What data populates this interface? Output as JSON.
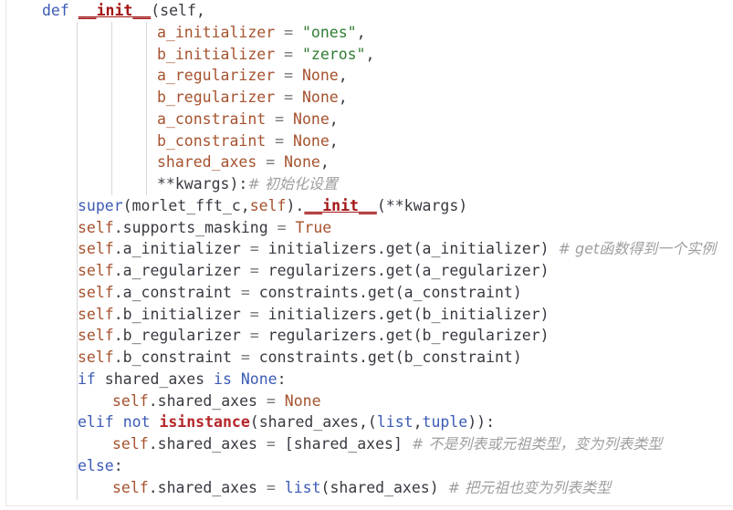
{
  "code": {
    "lines": [
      {
        "indent": 0,
        "tokens": [
          {
            "t": "def",
            "c": "kw"
          },
          {
            "t": " ",
            "c": ""
          },
          {
            "t": "__init__",
            "c": "dunder"
          },
          {
            "t": "(self,",
            "c": "call"
          }
        ]
      },
      {
        "indent": 1,
        "tokens": [
          {
            "t": "a_initializer",
            "c": "param"
          },
          {
            "t": " = ",
            "c": "op"
          },
          {
            "t": "\"ones\"",
            "c": "str"
          },
          {
            "t": ",",
            "c": "call"
          }
        ]
      },
      {
        "indent": 1,
        "tokens": [
          {
            "t": "b_initializer",
            "c": "param"
          },
          {
            "t": " = ",
            "c": "op"
          },
          {
            "t": "\"zeros\"",
            "c": "str"
          },
          {
            "t": ",",
            "c": "call"
          }
        ]
      },
      {
        "indent": 1,
        "tokens": [
          {
            "t": "a_regularizer",
            "c": "param"
          },
          {
            "t": " = ",
            "c": "op"
          },
          {
            "t": "None",
            "c": "const"
          },
          {
            "t": ",",
            "c": "call"
          }
        ]
      },
      {
        "indent": 1,
        "tokens": [
          {
            "t": "b_regularizer",
            "c": "param"
          },
          {
            "t": " = ",
            "c": "op"
          },
          {
            "t": "None",
            "c": "const"
          },
          {
            "t": ",",
            "c": "call"
          }
        ]
      },
      {
        "indent": 1,
        "tokens": [
          {
            "t": "a_constraint",
            "c": "param"
          },
          {
            "t": " = ",
            "c": "op"
          },
          {
            "t": "None",
            "c": "const"
          },
          {
            "t": ",",
            "c": "call"
          }
        ]
      },
      {
        "indent": 1,
        "tokens": [
          {
            "t": "b_constraint",
            "c": "param"
          },
          {
            "t": " = ",
            "c": "op"
          },
          {
            "t": "None",
            "c": "const"
          },
          {
            "t": ",",
            "c": "call"
          }
        ]
      },
      {
        "indent": 1,
        "tokens": [
          {
            "t": "shared_axes",
            "c": "param"
          },
          {
            "t": " = ",
            "c": "op"
          },
          {
            "t": "None",
            "c": "const"
          },
          {
            "t": ",",
            "c": "call"
          }
        ]
      },
      {
        "indent": 1,
        "tokens": [
          {
            "t": "**kwargs",
            "c": "call"
          },
          {
            "t": "):",
            "c": "call"
          },
          {
            "t": "# 初始化设置",
            "c": "cmt"
          }
        ]
      },
      {
        "indent": 2,
        "tokens": [
          {
            "t": "super",
            "c": "kw"
          },
          {
            "t": "(morlet_fft_c,",
            "c": "call"
          },
          {
            "t": "self",
            "c": "self"
          },
          {
            "t": ").",
            "c": "call"
          },
          {
            "t": "__init__",
            "c": "dunder"
          },
          {
            "t": "(**kwargs)",
            "c": "call"
          }
        ]
      },
      {
        "indent": 2,
        "tokens": [
          {
            "t": "self",
            "c": "self"
          },
          {
            "t": ".supports_masking",
            "c": "call"
          },
          {
            "t": " = ",
            "c": "op"
          },
          {
            "t": "True",
            "c": "const"
          }
        ]
      },
      {
        "indent": 2,
        "tokens": [
          {
            "t": "self",
            "c": "self"
          },
          {
            "t": ".a_initializer",
            "c": "call"
          },
          {
            "t": " = ",
            "c": "op"
          },
          {
            "t": "initializers.get(a_initializer) ",
            "c": "call"
          },
          {
            "t": "# get函数得到一个实例",
            "c": "cmt"
          }
        ]
      },
      {
        "indent": 2,
        "tokens": [
          {
            "t": "self",
            "c": "self"
          },
          {
            "t": ".a_regularizer",
            "c": "call"
          },
          {
            "t": " = ",
            "c": "op"
          },
          {
            "t": "regularizers.get(a_regularizer)",
            "c": "call"
          }
        ]
      },
      {
        "indent": 2,
        "tokens": [
          {
            "t": "self",
            "c": "self"
          },
          {
            "t": ".a_constraint",
            "c": "call"
          },
          {
            "t": " = ",
            "c": "op"
          },
          {
            "t": "constraints.get(a_constraint)",
            "c": "call"
          }
        ]
      },
      {
        "indent": 2,
        "tokens": [
          {
            "t": "self",
            "c": "self"
          },
          {
            "t": ".b_initializer",
            "c": "call"
          },
          {
            "t": " = ",
            "c": "op"
          },
          {
            "t": "initializers.get(b_initializer)",
            "c": "call"
          }
        ]
      },
      {
        "indent": 2,
        "tokens": [
          {
            "t": "self",
            "c": "self"
          },
          {
            "t": ".b_regularizer",
            "c": "call"
          },
          {
            "t": " = ",
            "c": "op"
          },
          {
            "t": "regularizers.get(b_regularizer)",
            "c": "call"
          }
        ]
      },
      {
        "indent": 2,
        "tokens": [
          {
            "t": "self",
            "c": "self"
          },
          {
            "t": ".b_constraint",
            "c": "call"
          },
          {
            "t": " = ",
            "c": "op"
          },
          {
            "t": "constraints.get(b_constraint)",
            "c": "call"
          }
        ]
      },
      {
        "indent": 2,
        "tokens": [
          {
            "t": "if",
            "c": "kw"
          },
          {
            "t": " shared_axes ",
            "c": "call"
          },
          {
            "t": "is",
            "c": "kw"
          },
          {
            "t": " ",
            "c": ""
          },
          {
            "t": "None",
            "c": "kw"
          },
          {
            "t": ":",
            "c": "call"
          }
        ]
      },
      {
        "indent": 3,
        "tokens": [
          {
            "t": "self",
            "c": "self"
          },
          {
            "t": ".shared_axes",
            "c": "call"
          },
          {
            "t": " = ",
            "c": "op"
          },
          {
            "t": "None",
            "c": "const"
          }
        ]
      },
      {
        "indent": 2,
        "tokens": [
          {
            "t": "elif",
            "c": "kw"
          },
          {
            "t": " ",
            "c": ""
          },
          {
            "t": "not",
            "c": "kw"
          },
          {
            "t": " ",
            "c": ""
          },
          {
            "t": "isinstance",
            "c": "builtin"
          },
          {
            "t": "(shared_axes,(",
            "c": "call"
          },
          {
            "t": "list",
            "c": "kw"
          },
          {
            "t": ",",
            "c": "call"
          },
          {
            "t": "tuple",
            "c": "kw"
          },
          {
            "t": ")):",
            "c": "call"
          }
        ]
      },
      {
        "indent": 3,
        "tokens": [
          {
            "t": "self",
            "c": "self"
          },
          {
            "t": ".shared_axes",
            "c": "call"
          },
          {
            "t": " = ",
            "c": "op"
          },
          {
            "t": "[shared_axes] ",
            "c": "call"
          },
          {
            "t": "# 不是列表或元祖类型，变为列表类型",
            "c": "cmt"
          }
        ]
      },
      {
        "indent": 2,
        "tokens": [
          {
            "t": "else",
            "c": "kw"
          },
          {
            "t": ":",
            "c": "call"
          }
        ]
      },
      {
        "indent": 3,
        "tokens": [
          {
            "t": "self",
            "c": "self"
          },
          {
            "t": ".shared_axes",
            "c": "call"
          },
          {
            "t": " = ",
            "c": "op"
          },
          {
            "t": "list",
            "c": "kw"
          },
          {
            "t": "(shared_axes) ",
            "c": "call"
          },
          {
            "t": "# 把元祖也变为列表类型",
            "c": "cmt"
          }
        ]
      }
    ]
  }
}
